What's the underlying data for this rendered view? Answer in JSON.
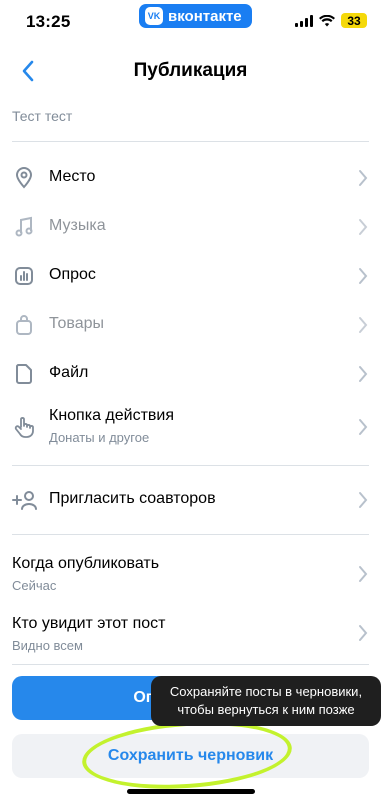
{
  "status": {
    "time": "13:25",
    "app_badge": "вконтакте",
    "battery": "33"
  },
  "nav": {
    "title": "Публикация"
  },
  "post": {
    "text": "Тест тест"
  },
  "menu": [
    {
      "name": "place",
      "label": "Место",
      "icon": "location-icon",
      "enabled": true
    },
    {
      "name": "music",
      "label": "Музыка",
      "icon": "music-icon",
      "enabled": false
    },
    {
      "name": "poll",
      "label": "Опрос",
      "icon": "poll-icon",
      "enabled": true
    },
    {
      "name": "goods",
      "label": "Товары",
      "icon": "bag-icon",
      "enabled": false
    },
    {
      "name": "file",
      "label": "Файл",
      "icon": "file-icon",
      "enabled": true
    },
    {
      "name": "action-button",
      "label": "Кнопка действия",
      "sub": "Донаты и другое",
      "icon": "hand-pointer-icon",
      "enabled": true
    }
  ],
  "coauthors": {
    "label": "Пригласить соавторов"
  },
  "when": {
    "label": "Когда опубликовать",
    "value": "Сейчас"
  },
  "who": {
    "label": "Кто увидит этот пост",
    "value": "Видно всем"
  },
  "buttons": {
    "publish": "Опубликовать",
    "draft": "Сохранить черновик"
  },
  "tooltip": {
    "text": "Сохраняйте посты в черновики, чтобы вернуться к ним позже"
  },
  "colors": {
    "accent": "#2688eb",
    "highlight": "#c3f22d",
    "vk_blue": "#1a7ef2"
  }
}
